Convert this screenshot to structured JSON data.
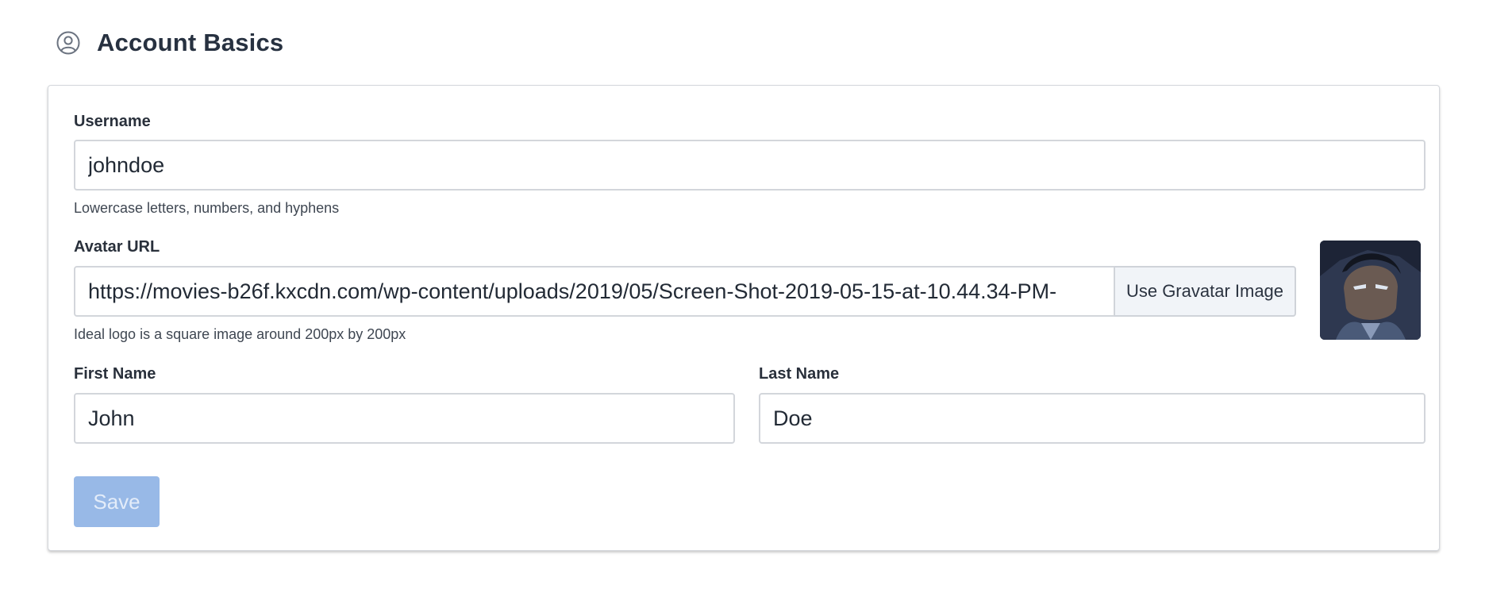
{
  "header": {
    "title": "Account Basics",
    "icon": "user-circle-icon"
  },
  "form": {
    "username": {
      "label": "Username",
      "value": "johndoe",
      "help": "Lowercase letters, numbers, and hyphens"
    },
    "avatar": {
      "label": "Avatar URL",
      "value": "https://movies-b26f.kxcdn.com/wp-content/uploads/2019/05/Screen-Shot-2019-05-15-at-10.44.34-PM-",
      "help": "Ideal logo is a square image around 200px by 200px",
      "gravatar_button": "Use Gravatar Image",
      "preview_icon": "avatar-image"
    },
    "first_name": {
      "label": "First Name",
      "value": "John"
    },
    "last_name": {
      "label": "Last Name",
      "value": "Doe"
    },
    "save_label": "Save"
  },
  "colors": {
    "save_disabled": "#98b9e7",
    "border": "#d3d6db",
    "text": "#212934"
  }
}
